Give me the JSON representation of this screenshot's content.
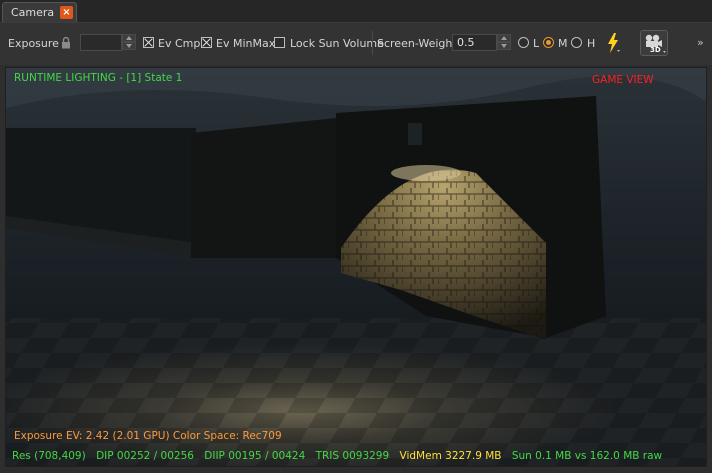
{
  "tab": {
    "label": "Camera",
    "close_glyph": "×"
  },
  "toolbar": {
    "exposure_label": "Exposure",
    "exposure_value": "",
    "ev_cmp_label": "Ev Cmp",
    "ev_cmp_checked": true,
    "ev_minmax_label": "Ev MinMax",
    "ev_minmax_checked": true,
    "lock_sun_label": "Lock Sun Volume",
    "lock_sun_checked": false,
    "screen_weight_label": "Screen-Weight",
    "screen_weight_value": "0.5",
    "quality_options": [
      {
        "label": "L",
        "selected": false
      },
      {
        "label": "M",
        "selected": true
      },
      {
        "label": "H",
        "selected": false
      }
    ],
    "bolt_icon": "lightning-icon",
    "camera_icon": "camera-3d-icon",
    "camera_icon_badge": "3D",
    "overflow_glyph": "»"
  },
  "viewport": {
    "title": "RUNTIME LIGHTING - [1] State 1",
    "mode": "GAME VIEW",
    "exposure_line": "Exposure EV: 2.42 (2.01 GPU)  Color Space: Rec709",
    "stats": {
      "res": "Res (708,409)",
      "dip": "DIP 00252 / 00256",
      "diip": "DIIP 00195 / 00424",
      "tris": "TRIS 0093299",
      "vidmem": "VidMem 3227.9 MB",
      "sun": "Sun 0.1 MB vs 162.0 MB raw"
    }
  },
  "colors": {
    "overlay_green": "#44d844",
    "overlay_red": "#ff2020",
    "overlay_orange": "#ff9a3c",
    "overlay_yellow": "#ffe03c",
    "accent_orange": "#e89a2c"
  }
}
